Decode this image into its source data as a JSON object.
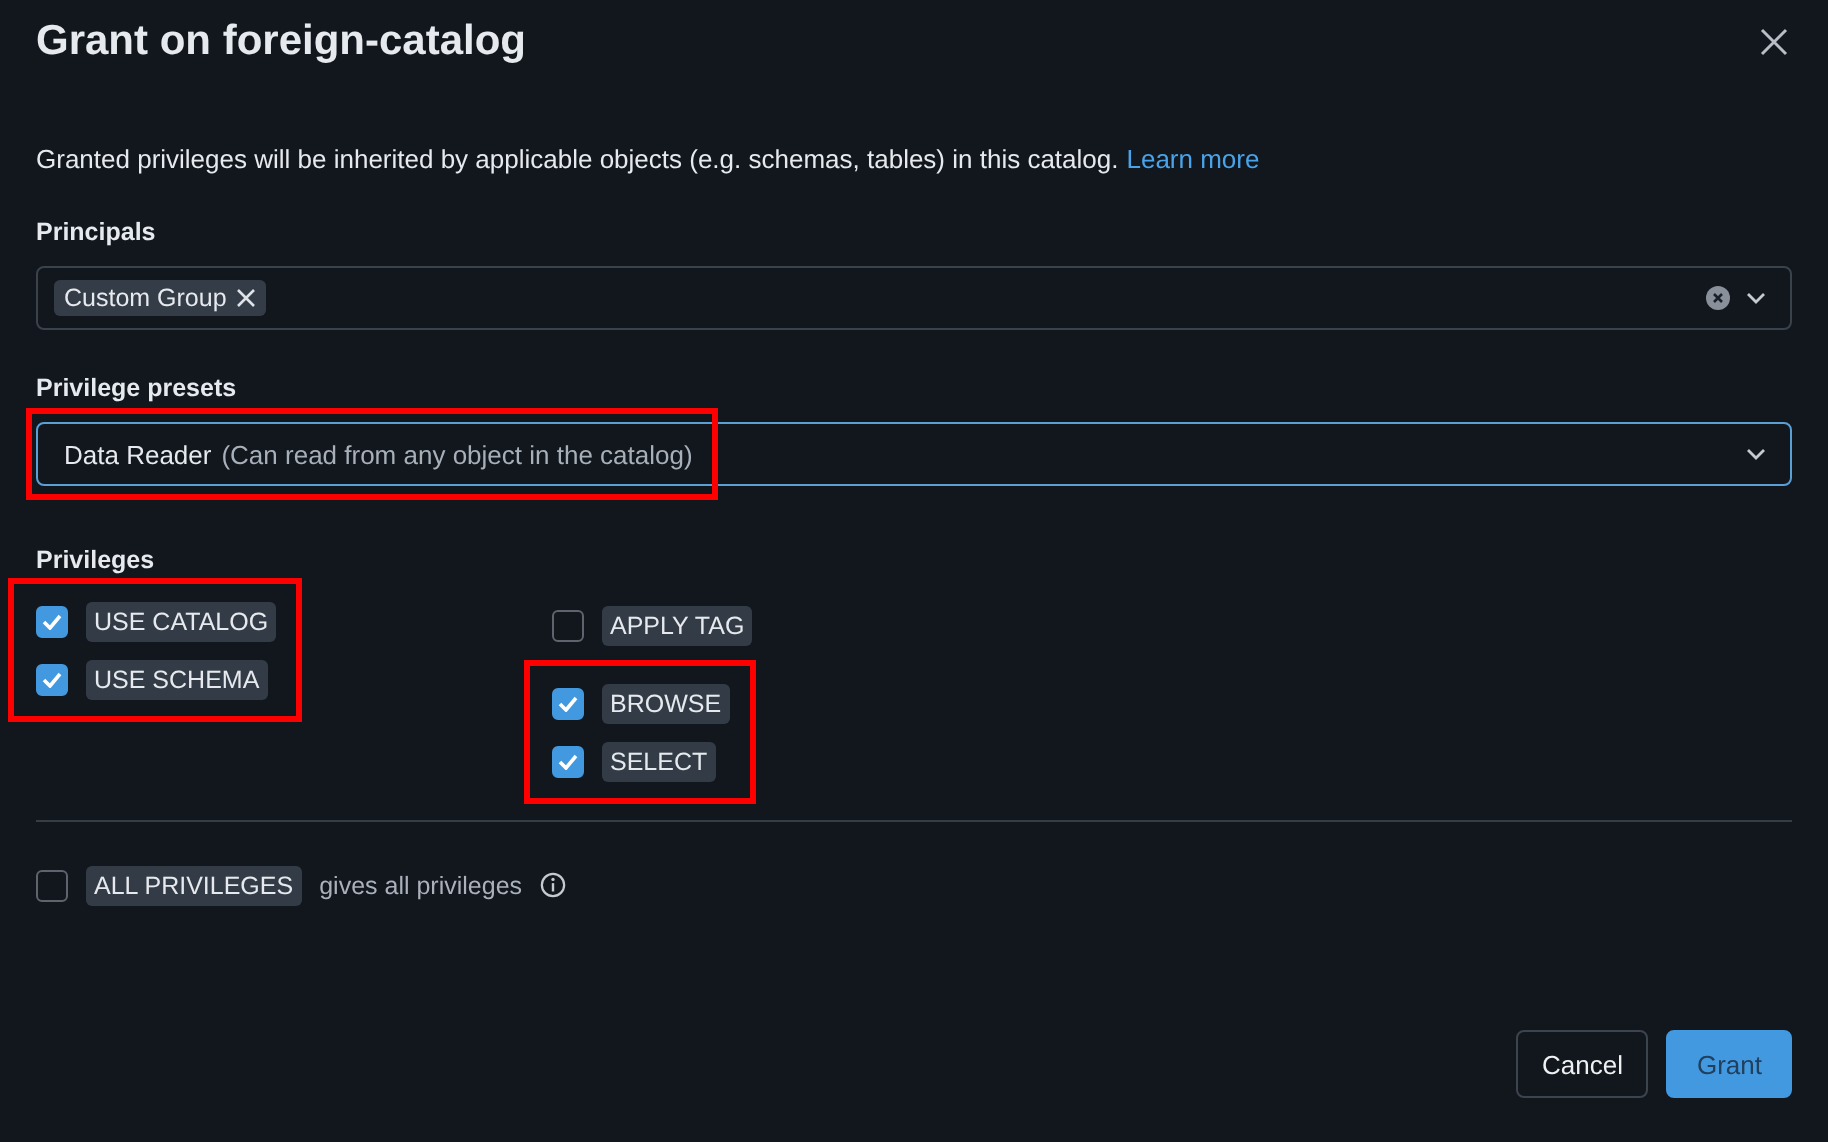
{
  "dialog": {
    "title": "Grant on foreign-catalog",
    "description": "Granted privileges will be inherited by applicable objects (e.g. schemas, tables) in this catalog.",
    "learn_more": "Learn more"
  },
  "principals": {
    "label": "Principals",
    "tags": [
      {
        "label": "Custom Group"
      }
    ]
  },
  "presets": {
    "label": "Privilege presets",
    "value": "Data Reader",
    "hint": "(Can read from any object in the catalog)",
    "highlighted": true
  },
  "privileges": {
    "label": "Privileges",
    "columns": [
      [
        {
          "label": "USE CATALOG",
          "checked": true,
          "highlighted": true
        },
        {
          "label": "USE SCHEMA",
          "checked": true,
          "highlighted": true
        }
      ],
      [
        {
          "label": "APPLY TAG",
          "checked": false,
          "highlighted": false
        },
        {
          "label": "BROWSE",
          "checked": true,
          "highlighted": true
        },
        {
          "label": "SELECT",
          "checked": true,
          "highlighted": true
        }
      ]
    ]
  },
  "all_privileges": {
    "label": "ALL PRIVILEGES",
    "checked": false,
    "note": "gives all privileges"
  },
  "buttons": [
    {
      "label": "Cancel",
      "kind": "secondary"
    },
    {
      "label": "Grant",
      "kind": "primary"
    }
  ]
}
